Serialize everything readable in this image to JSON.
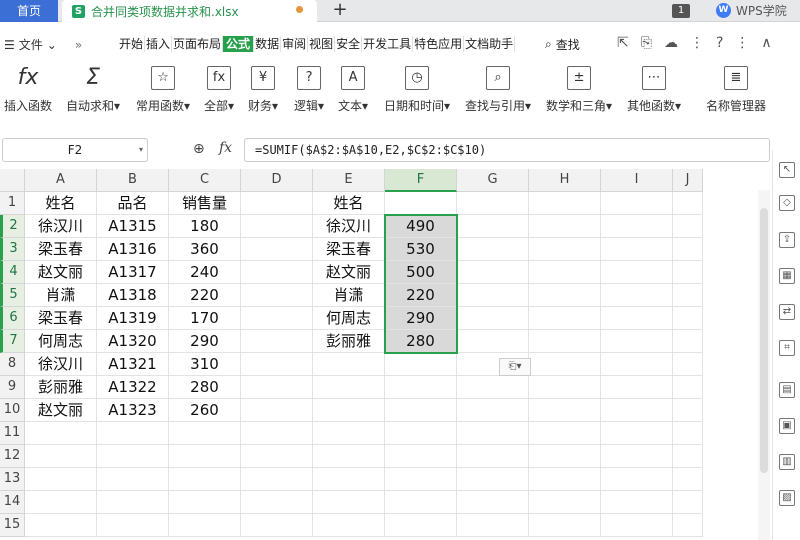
{
  "tabbar": {
    "home_label": "首页",
    "file_icon": "S",
    "file_name": "合并同类项数据并求和.xlsx",
    "new_tab_icon": "+",
    "tab_count": "1",
    "brand_logo": "W",
    "brand_name": "WPS学院"
  },
  "menu": {
    "hamburger": "☰",
    "file_label": "文件",
    "more": "»",
    "items": [
      "开始",
      "插入",
      "页面布局",
      "公式",
      "数据",
      "审阅",
      "视图",
      "安全",
      "开发工具",
      "特色应用",
      "文档助手"
    ],
    "active_index": 3,
    "search_label": "查找",
    "right_icons": [
      "⇱",
      "⎘",
      "☁",
      "⋮",
      "?",
      "⋮",
      "∧"
    ]
  },
  "ribbon": {
    "buttons": [
      {
        "label": "插入函数",
        "icon": "fx"
      },
      {
        "label": "自动求和▾",
        "icon": "Σ"
      },
      {
        "label": "常用函数▾",
        "icon": "☆"
      },
      {
        "label": "全部▾",
        "icon": "fx"
      },
      {
        "label": "财务▾",
        "icon": "¥"
      },
      {
        "label": "逻辑▾",
        "icon": "?"
      },
      {
        "label": "文本▾",
        "icon": "A"
      },
      {
        "label": "日期和时间▾",
        "icon": "◷"
      },
      {
        "label": "查找与引用▾",
        "icon": "⌕"
      },
      {
        "label": "数学和三角▾",
        "icon": "±"
      },
      {
        "label": "其他函数▾",
        "icon": "⋯"
      },
      {
        "label": "名称管理器",
        "icon": "≣"
      }
    ]
  },
  "formula": {
    "name_box": "F2",
    "zoom_icon": "⊕",
    "fx_label": "fx",
    "value": "=SUMIF($A$2:$A$10,E2,$C$2:$C$10)"
  },
  "sheet": {
    "columns": [
      "A",
      "B",
      "C",
      "D",
      "E",
      "F",
      "G",
      "H",
      "I",
      "J"
    ],
    "rows": [
      "1",
      "2",
      "3",
      "4",
      "5",
      "6",
      "7",
      "8",
      "9",
      "10",
      "11",
      "12",
      "13",
      "14",
      "15"
    ],
    "selected_column": "F",
    "selected_rows": [
      "2",
      "3",
      "4",
      "5",
      "6",
      "7"
    ],
    "cells": {
      "A1": "姓名",
      "B1": "品名",
      "C1": "销售量",
      "E1": "姓名",
      "A2": "徐汉川",
      "B2": "A1315",
      "C2": "180",
      "E2": "徐汉川",
      "F2": "490",
      "A3": "梁玉春",
      "B3": "A1316",
      "C3": "360",
      "E3": "梁玉春",
      "F3": "530",
      "A4": "赵文丽",
      "B4": "A1317",
      "C4": "240",
      "E4": "赵文丽",
      "F4": "500",
      "A5": "肖潇",
      "B5": "A1318",
      "C5": "220",
      "E5": "肖潇",
      "F5": "220",
      "A6": "梁玉春",
      "B6": "A1319",
      "C6": "170",
      "E6": "何周志",
      "F6": "290",
      "A7": "何周志",
      "B7": "A1320",
      "C7": "290",
      "E7": "彭丽雅",
      "F7": "280",
      "A8": "徐汉川",
      "B8": "A1321",
      "C8": "310",
      "A9": "彭丽雅",
      "B9": "A1322",
      "C9": "280",
      "A10": "赵文丽",
      "B10": "A1323",
      "C10": "260"
    },
    "paste_options_icon": "⎗▾"
  },
  "sidepanel": {
    "icons": [
      "↖",
      "◇",
      "⇪",
      "▦",
      "⇄",
      "⌗",
      "▤",
      "▣",
      "▥",
      "▨"
    ]
  }
}
